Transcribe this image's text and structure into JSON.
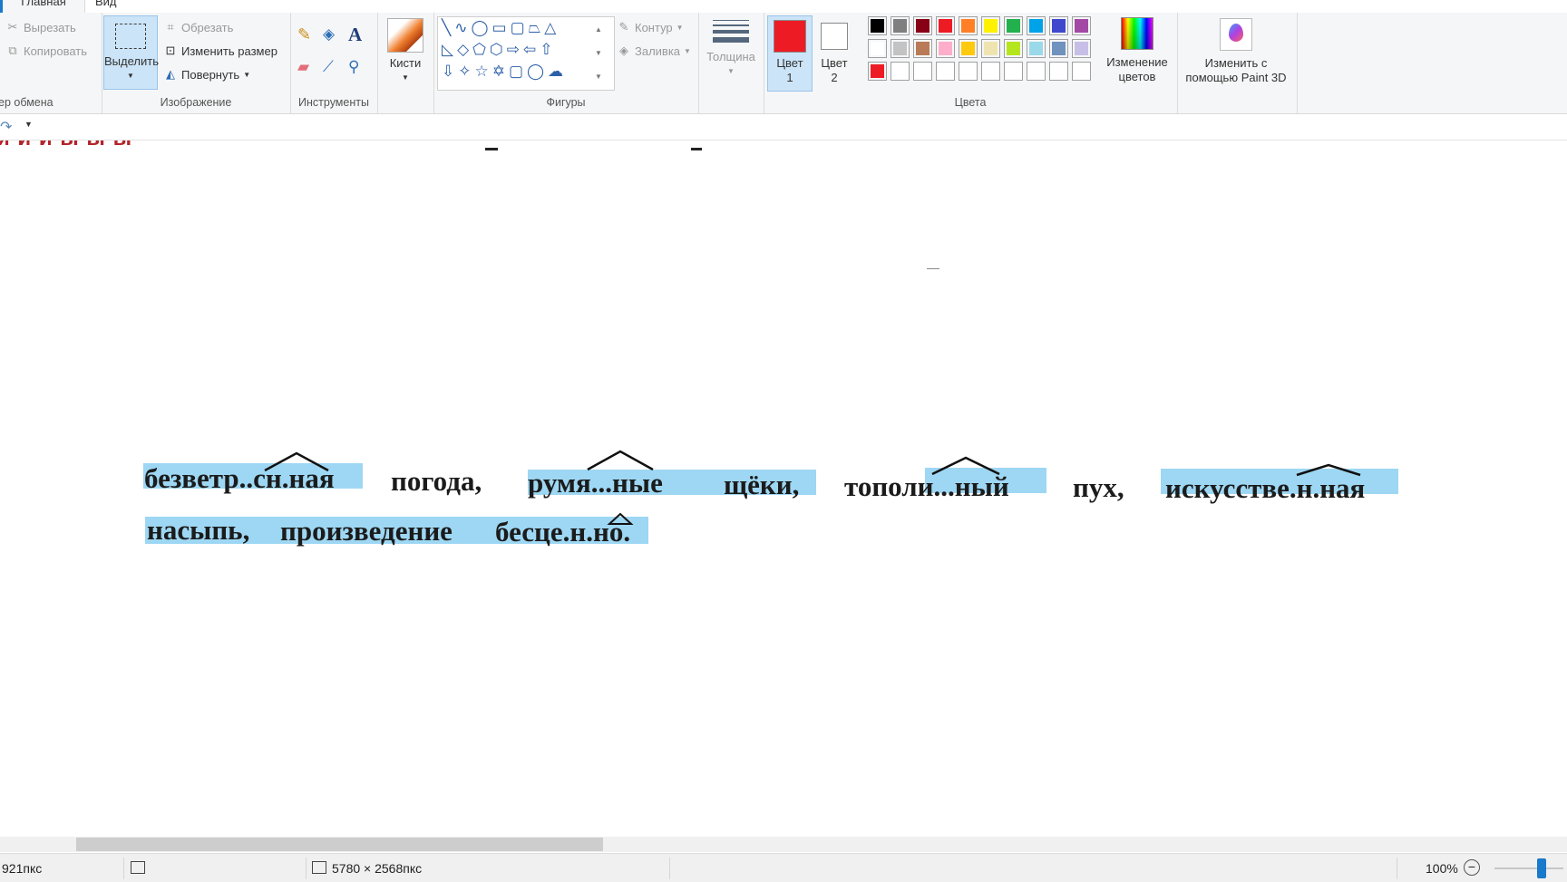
{
  "tabs": {
    "home": "Главная",
    "view": "Вид"
  },
  "clipboard": {
    "cut": "Вырезать",
    "copy": "Копировать",
    "label": "ер обмена"
  },
  "image": {
    "select": "Выделить",
    "crop": "Обрезать",
    "resize": "Изменить размер",
    "rotate": "Повернуть",
    "label": "Изображение"
  },
  "tools": {
    "label": "Инструменты"
  },
  "brushes": {
    "label": "Кисти"
  },
  "shapes": {
    "outline": "Контур",
    "fill": "Заливка",
    "label": "Фигуры"
  },
  "size": {
    "label": "Толщина"
  },
  "colors": {
    "color1_line1": "Цвет",
    "color1_line2": "1",
    "color2_line1": "Цвет",
    "color2_line2": "2",
    "edit_line1": "Изменение",
    "edit_line2": "цветов",
    "label": "Цвета",
    "color1_value": "#ed1c24",
    "color2_value": "#ffffff",
    "palette": [
      "#000000",
      "#7f7f7f",
      "#880015",
      "#ed1c24",
      "#ff7f27",
      "#fff200",
      "#22b14c",
      "#00a2e8",
      "#3f48cc",
      "#a349a4",
      "#ffffff",
      "#c3c3c3",
      "#b97a57",
      "#ffaec9",
      "#ffc90e",
      "#efe4b0",
      "#b5e61d",
      "#99d9ea",
      "#7092be",
      "#c8bfe7",
      "#ed1c24",
      "",
      "",
      "",
      "",
      "",
      "",
      "",
      "",
      ""
    ]
  },
  "paint3d": {
    "line1": "Изменить с",
    "line2": "помощью Paint 3D"
  },
  "canvas": {
    "partial_heading": "и и и ы ы ы",
    "line1": [
      "безветр..сн.ная",
      "погода,",
      "румя...ные",
      "щёки,",
      "тополи...ный",
      "пух,",
      "искусстве.н.ная"
    ],
    "line2": [
      "насыпь,",
      "произведение",
      "бесце.н.но."
    ]
  },
  "status": {
    "cursor": "921пкс",
    "dimensions": "5780 × 2568пкс",
    "zoom": "100%"
  }
}
